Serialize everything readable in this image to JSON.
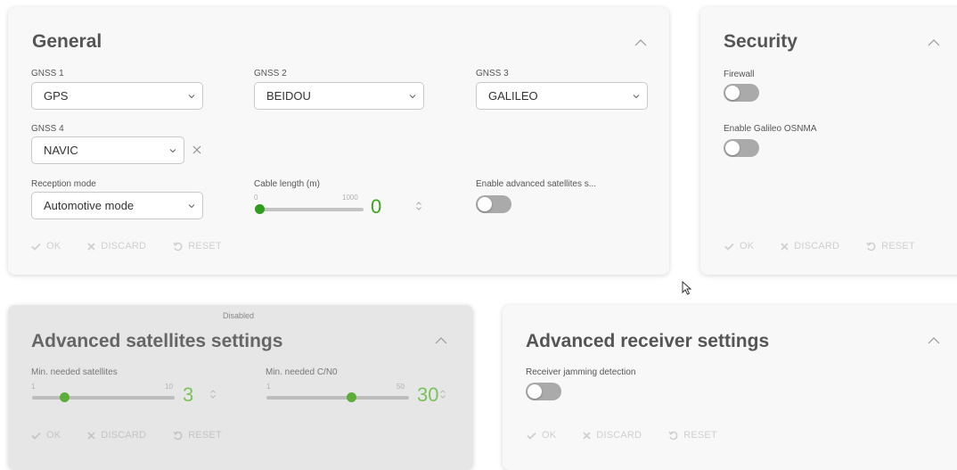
{
  "colors": {
    "accent": "#2e9c1c",
    "value_green": "#3aa51d",
    "toggle_off": "#aaaaaa"
  },
  "general": {
    "title": "General",
    "gnss1": {
      "label": "GNSS 1",
      "value": "GPS"
    },
    "gnss2": {
      "label": "GNSS 2",
      "value": "BEIDOU"
    },
    "gnss3": {
      "label": "GNSS 3",
      "value": "GALILEO"
    },
    "gnss4": {
      "label": "GNSS 4",
      "value": "NAVIC"
    },
    "reception": {
      "label": "Reception mode",
      "value": "Automotive mode"
    },
    "cable": {
      "label": "Cable length (m)",
      "min": "0",
      "max": "1000",
      "value": "0",
      "level": 0
    },
    "advanced_toggle": {
      "label": "Enable advanced satellites s...",
      "on": false
    },
    "actions": {
      "ok": "OK",
      "discard": "DISCARD",
      "reset": "RESET"
    }
  },
  "security": {
    "title": "Security",
    "firewall": {
      "label": "Firewall",
      "on": false
    },
    "osnma": {
      "label": "Enable Galileo OSNMA",
      "on": false
    },
    "actions": {
      "ok": "OK",
      "discard": "DISCARD",
      "reset": "RESET"
    }
  },
  "advanced_satellites": {
    "disabled_label": "Disabled",
    "title": "Advanced satellites settings",
    "min_sats": {
      "label": "Min. needed satellites",
      "min": "1",
      "max": "10",
      "value": "3",
      "level": 0.222
    },
    "min_cn0": {
      "label": "Min. needed C/N0",
      "min": "1",
      "max": "50",
      "value": "30",
      "level": 0.592
    },
    "actions": {
      "ok": "OK",
      "discard": "DISCARD",
      "reset": "RESET"
    }
  },
  "advanced_receiver": {
    "title": "Advanced receiver settings",
    "jamming": {
      "label": "Receiver jamming detection",
      "on": false
    },
    "actions": {
      "ok": "OK",
      "discard": "DISCARD",
      "reset": "RESET"
    }
  }
}
